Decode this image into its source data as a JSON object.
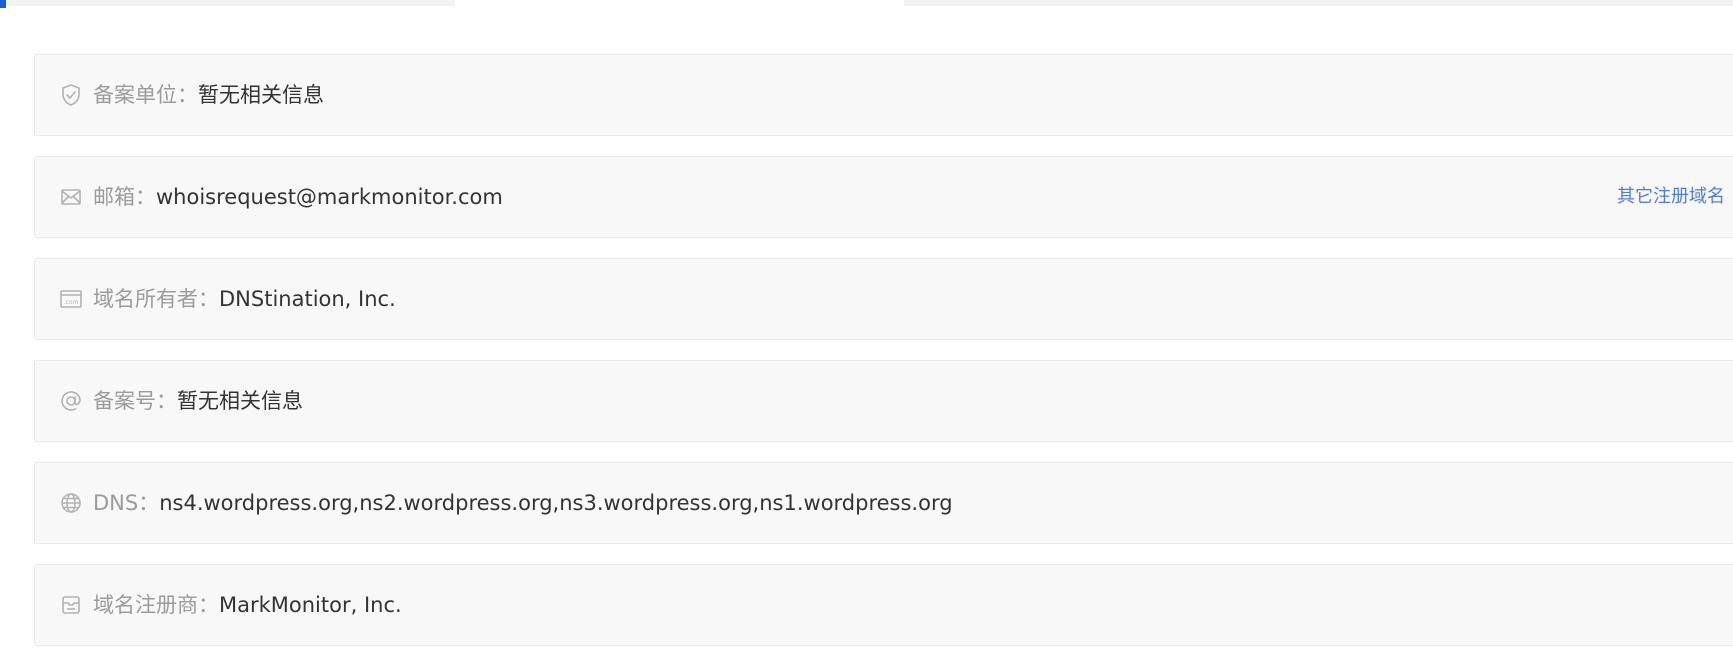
{
  "rows": [
    {
      "label": "备案单位：",
      "value": "暂无相关信息",
      "icon": "shield-check-icon"
    },
    {
      "label": "邮箱：",
      "value": "whoisrequest@markmonitor.com",
      "icon": "mail-icon",
      "link": "其它注册域名"
    },
    {
      "label": "域名所有者：",
      "value": "DNStination, Inc.",
      "icon": "com-card-icon"
    },
    {
      "label": "备案号：",
      "value": "暂无相关信息",
      "icon": "at-icon"
    },
    {
      "label": "DNS：",
      "value": "ns4.wordpress.org,ns2.wordpress.org,ns3.wordpress.org,ns1.wordpress.org",
      "icon": "globe-icon"
    },
    {
      "label": "域名注册商：",
      "value": "MarkMonitor, Inc.",
      "icon": "registrar-icon"
    }
  ],
  "colors": {
    "label": "#9b9b9b",
    "value": "#333333",
    "link": "#4e7ae6",
    "row_background": "#f8f8f8",
    "row_border": "#e8e8e8",
    "accent": "#1b5fd1"
  }
}
